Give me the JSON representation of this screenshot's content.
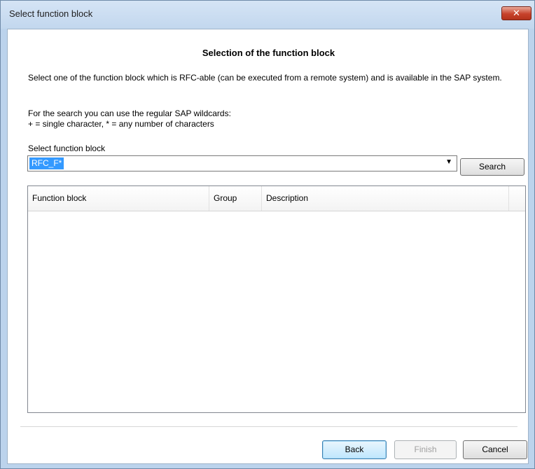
{
  "window": {
    "title": "Select function block",
    "close_glyph": "✕"
  },
  "page": {
    "heading": "Selection of the function block",
    "description": "Select one of the function block which is RFC-able (can be executed from a remote system) and is available in the SAP system.",
    "hint_line1": "For the search you can use the regular SAP wildcards:",
    "hint_line2": "+ = single character, * = any number of characters"
  },
  "search": {
    "label": "Select function block",
    "value": "RFC_F*",
    "dropdown_glyph": "▼",
    "button_label": "Search"
  },
  "table": {
    "columns": [
      "Function block",
      "Group",
      "Description"
    ],
    "rows": []
  },
  "footer": {
    "back_label": "Back",
    "finish_label": "Finish",
    "cancel_label": "Cancel"
  }
}
